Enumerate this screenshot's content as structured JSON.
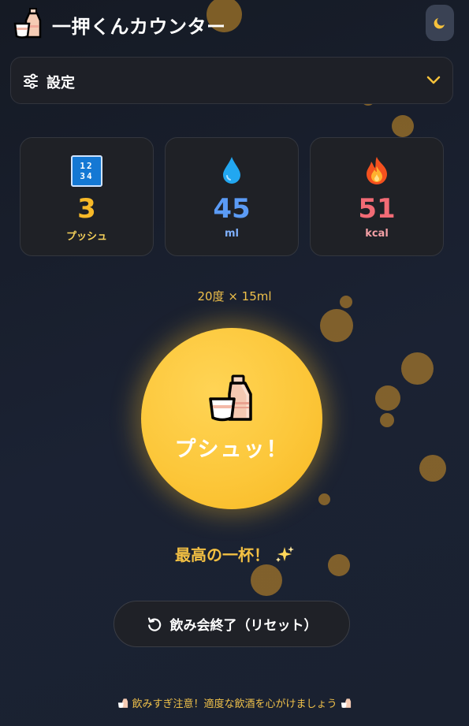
{
  "header": {
    "title": "一押くんカウンター",
    "logo_icon": "tokkuri-icon",
    "theme_toggle_icon": "moon-icon"
  },
  "settings": {
    "label": "設定",
    "icon": "sliders-icon",
    "expand_icon": "chevron-down-icon"
  },
  "stats": [
    {
      "icon": "digits-icon",
      "value": "3",
      "unit": "プッシュ",
      "color": "#f7b928",
      "unit_color": "#f4d05a"
    },
    {
      "icon": "droplet-icon",
      "value": "45",
      "unit": "ml",
      "color": "#5b9bf5",
      "unit_color": "#7fb1ff"
    },
    {
      "icon": "fire-icon",
      "value": "51",
      "unit": "kcal",
      "color": "#f26b75",
      "unit_color": "#f4a0a5"
    }
  ],
  "digits_icon_text": {
    "row1": "12",
    "row2": "34"
  },
  "spec": "20度 × 15ml",
  "push_button": {
    "label": "プシュッ！",
    "icon": "tokkuri-icon"
  },
  "message": {
    "text": "最高の一杯！",
    "icon": "sparkles-icon"
  },
  "reset_button": {
    "label": "飲み会終了（リセット）",
    "icon": "reset-icon"
  },
  "footer": {
    "text": "飲みすぎ注意！適度な飲酒を心がけましょう"
  },
  "colors": {
    "accent": "#fcc73a",
    "background": "#1b2233",
    "card": "#1f2126"
  }
}
